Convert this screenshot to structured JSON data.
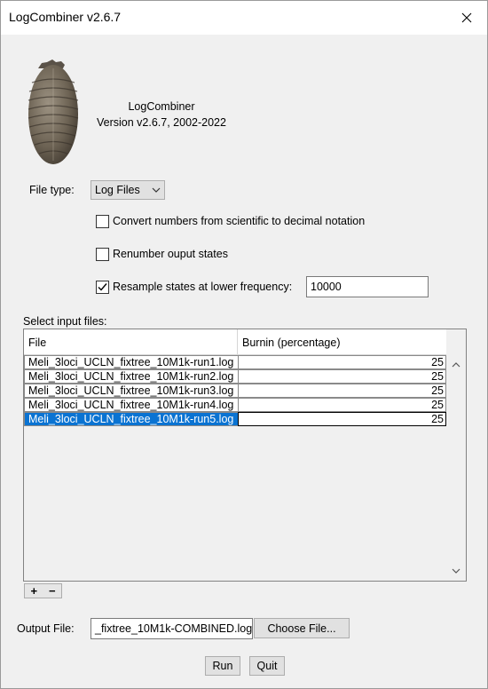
{
  "window": {
    "title": "LogCombiner v2.6.7"
  },
  "about": {
    "app_name": "LogCombiner",
    "version_line": "Version v2.6.7, 2002-2022"
  },
  "file_type": {
    "label": "File type:",
    "selected": "Log Files"
  },
  "options": {
    "convert": {
      "label": "Convert numbers from scientific to decimal notation",
      "checked": false
    },
    "renumber": {
      "label": "Renumber ouput states",
      "checked": false
    },
    "resample": {
      "label": "Resample states at lower frequency:",
      "checked": true,
      "value": "10000"
    }
  },
  "input_files": {
    "label": "Select input files:",
    "columns": [
      "File",
      "Burnin (percentage)"
    ],
    "rows": [
      {
        "file": "Meli_3loci_UCLN_fixtree_10M1k-run1.log",
        "burnin": "25"
      },
      {
        "file": "Meli_3loci_UCLN_fixtree_10M1k-run2.log",
        "burnin": "25"
      },
      {
        "file": "Meli_3loci_UCLN_fixtree_10M1k-run3.log",
        "burnin": "25"
      },
      {
        "file": "Meli_3loci_UCLN_fixtree_10M1k-run4.log",
        "burnin": "25"
      },
      {
        "file": "Meli_3loci_UCLN_fixtree_10M1k-run5.log",
        "burnin": "25"
      }
    ],
    "add_label": "+",
    "remove_label": "−"
  },
  "output": {
    "label": "Output File:",
    "value": "_fixtree_10M1k-COMBINED.log",
    "choose_label": "Choose File..."
  },
  "actions": {
    "run_label": "Run",
    "quit_label": "Quit"
  },
  "colors": {
    "selection": "#0a73d2",
    "dialog_bg": "#f0f0f0"
  }
}
